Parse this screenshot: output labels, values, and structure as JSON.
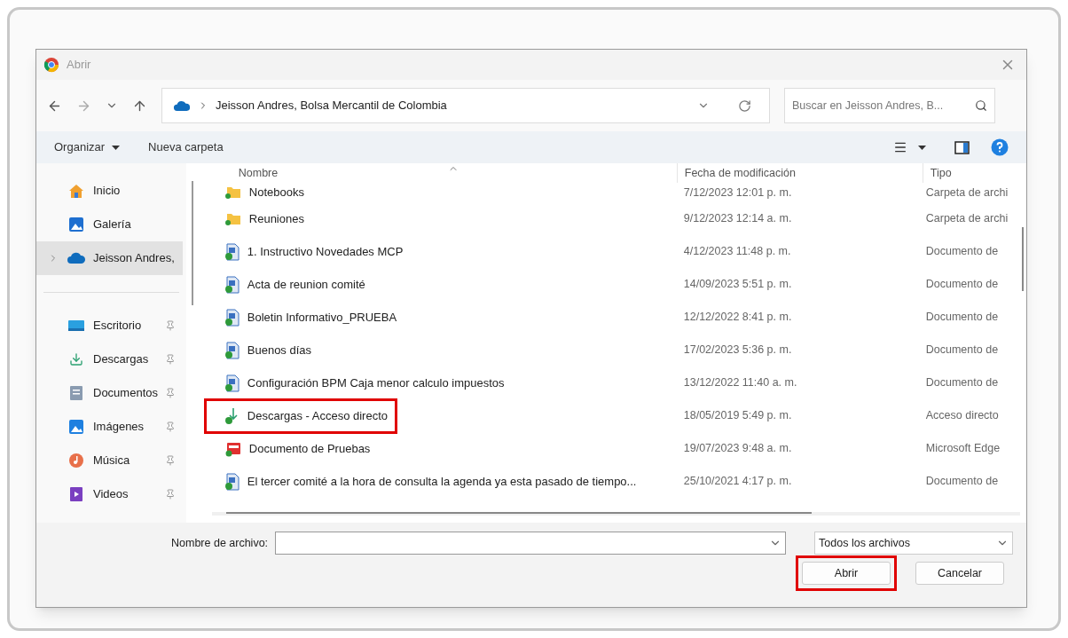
{
  "window": {
    "title": "Abrir"
  },
  "address": {
    "path": "Jeisson Andres, Bolsa Mercantil de Colombia"
  },
  "search": {
    "placeholder": "Buscar en Jeisson Andres, B..."
  },
  "toolbar": [
    {
      "label": "Organizar",
      "dropdown": true
    },
    {
      "label": "Nueva carpeta",
      "dropdown": false
    }
  ],
  "sidebar": {
    "items": [
      {
        "label": "Inicio",
        "kind": "home",
        "pinned": false,
        "selected": false,
        "expandable": false
      },
      {
        "label": "Galería",
        "kind": "gallery",
        "pinned": false,
        "selected": false,
        "expandable": false
      },
      {
        "label": "Jeisson Andres,",
        "kind": "cloud",
        "pinned": false,
        "selected": true,
        "expandable": true
      },
      {
        "label": "Escritorio",
        "kind": "desktop",
        "pinned": true,
        "selected": false,
        "expandable": false
      },
      {
        "label": "Descargas",
        "kind": "download",
        "pinned": true,
        "selected": false,
        "expandable": false
      },
      {
        "label": "Documentos",
        "kind": "documents",
        "pinned": true,
        "selected": false,
        "expandable": false
      },
      {
        "label": "Imágenes",
        "kind": "images",
        "pinned": true,
        "selected": false,
        "expandable": false
      },
      {
        "label": "Música",
        "kind": "music",
        "pinned": true,
        "selected": false,
        "expandable": false
      },
      {
        "label": "Videos",
        "kind": "videos",
        "pinned": true,
        "selected": false,
        "expandable": false
      }
    ]
  },
  "table": {
    "columns": [
      {
        "label": "Nombre",
        "sorted": true
      },
      {
        "label": "Fecha de modificación",
        "sorted": false
      },
      {
        "label": "Tipo",
        "sorted": false
      }
    ],
    "rows": [
      {
        "name": "Notebooks",
        "date": "7/12/2023 12:01 p. m.",
        "type": "Carpeta de archi",
        "kind": "folder",
        "annotated": false
      },
      {
        "name": "Reuniones",
        "date": "9/12/2023 12:14 a. m.",
        "type": "Carpeta de archi",
        "kind": "folder",
        "annotated": false
      },
      {
        "name": "1. Instructivo Novedades MCP",
        "date": "4/12/2023 11:48 p. m.",
        "type": "Documento de",
        "kind": "document",
        "annotated": false
      },
      {
        "name": "Acta de reunion comité",
        "date": "14/09/2023 5:51 p. m.",
        "type": "Documento de",
        "kind": "document",
        "annotated": false
      },
      {
        "name": "Boletin Informativo_PRUEBA",
        "date": "12/12/2022 8:41 p. m.",
        "type": "Documento de",
        "kind": "document",
        "annotated": false
      },
      {
        "name": "Buenos días",
        "date": "17/02/2023 5:36 p. m.",
        "type": "Documento de",
        "kind": "document",
        "annotated": false
      },
      {
        "name": "Configuración BPM Caja menor calculo impuestos",
        "date": "13/12/2022 11:40 a. m.",
        "type": "Documento de",
        "kind": "document",
        "annotated": false
      },
      {
        "name": "Descargas - Acceso directo",
        "date": "18/05/2019 5:49 p. m.",
        "type": "Acceso directo",
        "kind": "shortcut",
        "annotated": true
      },
      {
        "name": "Documento de Pruebas",
        "date": "19/07/2023 9:48 a. m.",
        "type": "Microsoft Edge",
        "kind": "pdf",
        "annotated": false
      },
      {
        "name": "El tercer comité a la hora de consulta la agenda ya esta pasado de tiempo...",
        "date": "25/10/2021 4:17 p. m.",
        "type": "Documento de",
        "kind": "document",
        "annotated": false
      }
    ]
  },
  "footer": {
    "filename_label": "Nombre de archivo:",
    "filter": "Todos los archivos",
    "buttons": [
      {
        "label": "Abrir",
        "annotated": true
      },
      {
        "label": "Cancelar",
        "annotated": false
      }
    ]
  }
}
